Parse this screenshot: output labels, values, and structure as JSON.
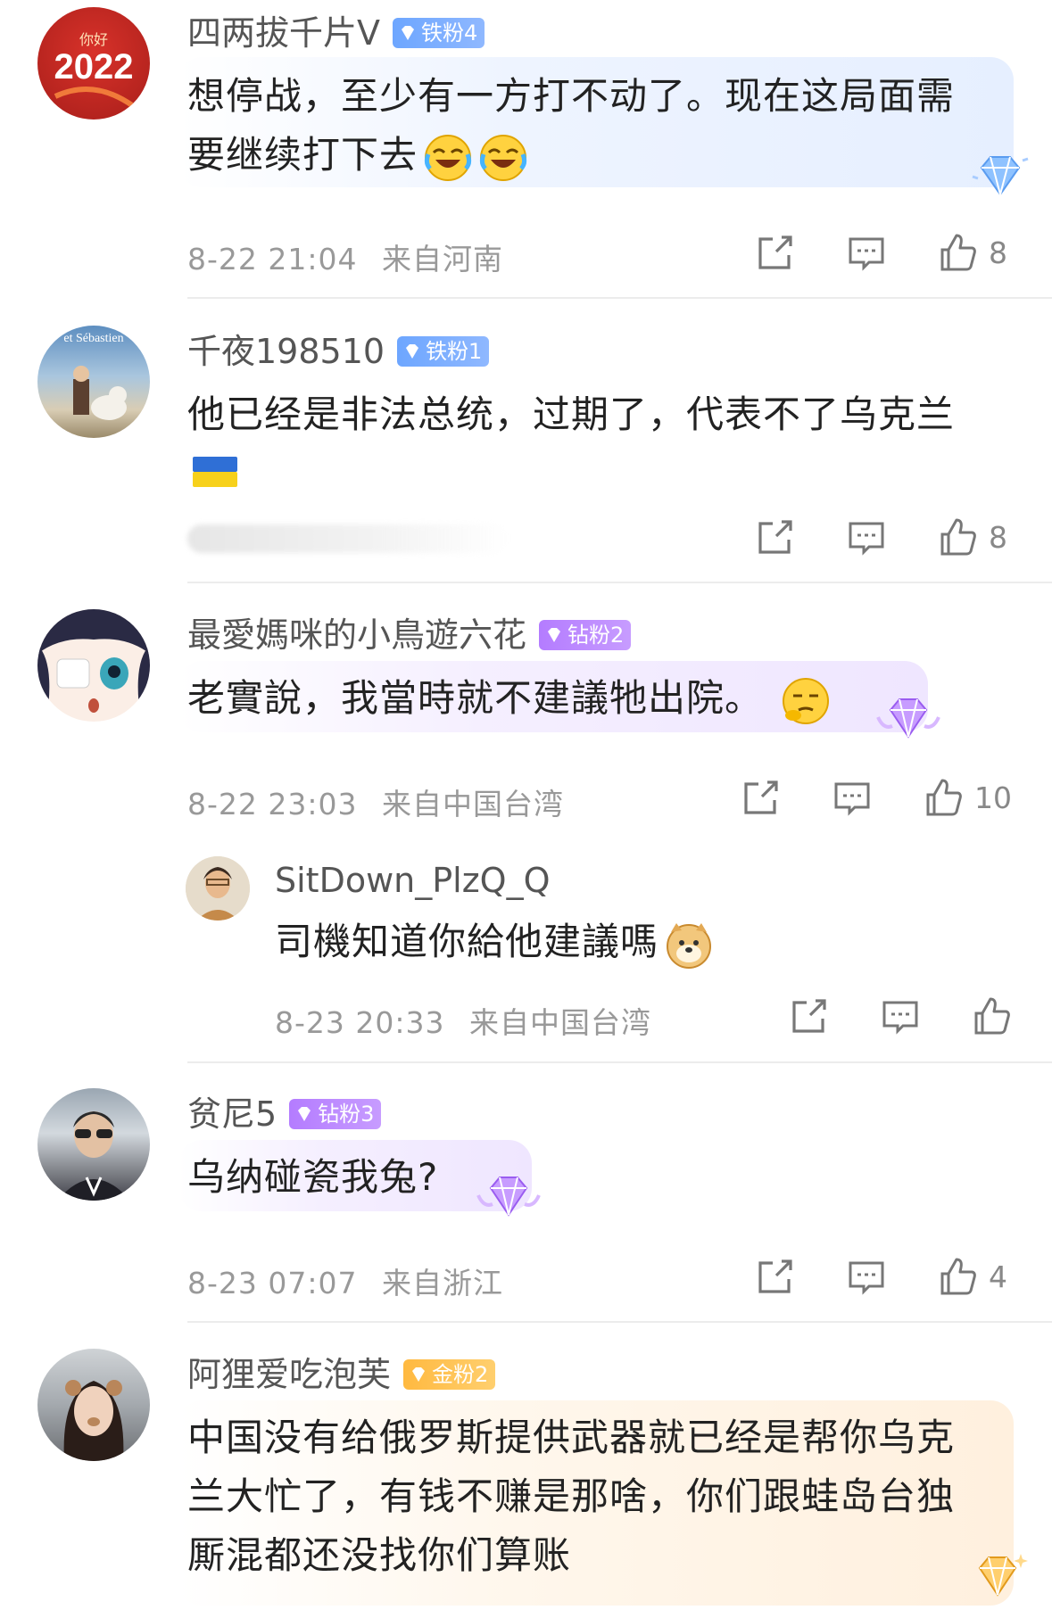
{
  "comments": [
    {
      "username": "四两拔千片V",
      "badge": "铁粉4",
      "text_line1": "想停战，至少有一方打不动了。现在这局面需",
      "text_line2": "要继续打下去",
      "time": "8-22 21:04",
      "location": "来自河南",
      "likes": "8",
      "avatar_text": "2022",
      "avatar_top_text": "你好"
    },
    {
      "username": "千夜198510",
      "badge": "铁粉1",
      "text_line1": "他已经是非法总统，过期了，代表不了乌克兰",
      "likes": "8",
      "avatar_text": "et Sébastien"
    },
    {
      "username": "最愛媽咪的小鳥遊六花",
      "badge": "钻粉2",
      "text_line1": "老實說，我當時就不建議牠出院。",
      "time": "8-22 23:03",
      "location": "来自中国台湾",
      "likes": "10",
      "reply": {
        "username": "SitDown_PlzQ_Q",
        "text": "司機知道你給他建議嗎",
        "time": "8-23 20:33",
        "location": "来自中国台湾"
      }
    },
    {
      "username": "贫尼5",
      "badge": "钻粉3",
      "text_line1": "乌纳碰瓷我兔?",
      "time": "8-23 07:07",
      "location": "来自浙江",
      "likes": "4"
    },
    {
      "username": "阿狸爱吃泡芙",
      "badge": "金粉2",
      "text_line1": "中国没有给俄罗斯提供武器就已经是帮你乌克",
      "text_line2": "兰大忙了，有钱不赚是那啥，你们跟蛙岛台独",
      "text_line3": "厮混都还没找你们算账"
    }
  ],
  "colors": {
    "iron_badge": "#6da6ff",
    "diamond_badge": "#b47cff",
    "gold_badge": "#ffb940",
    "meta_text": "#999999"
  }
}
